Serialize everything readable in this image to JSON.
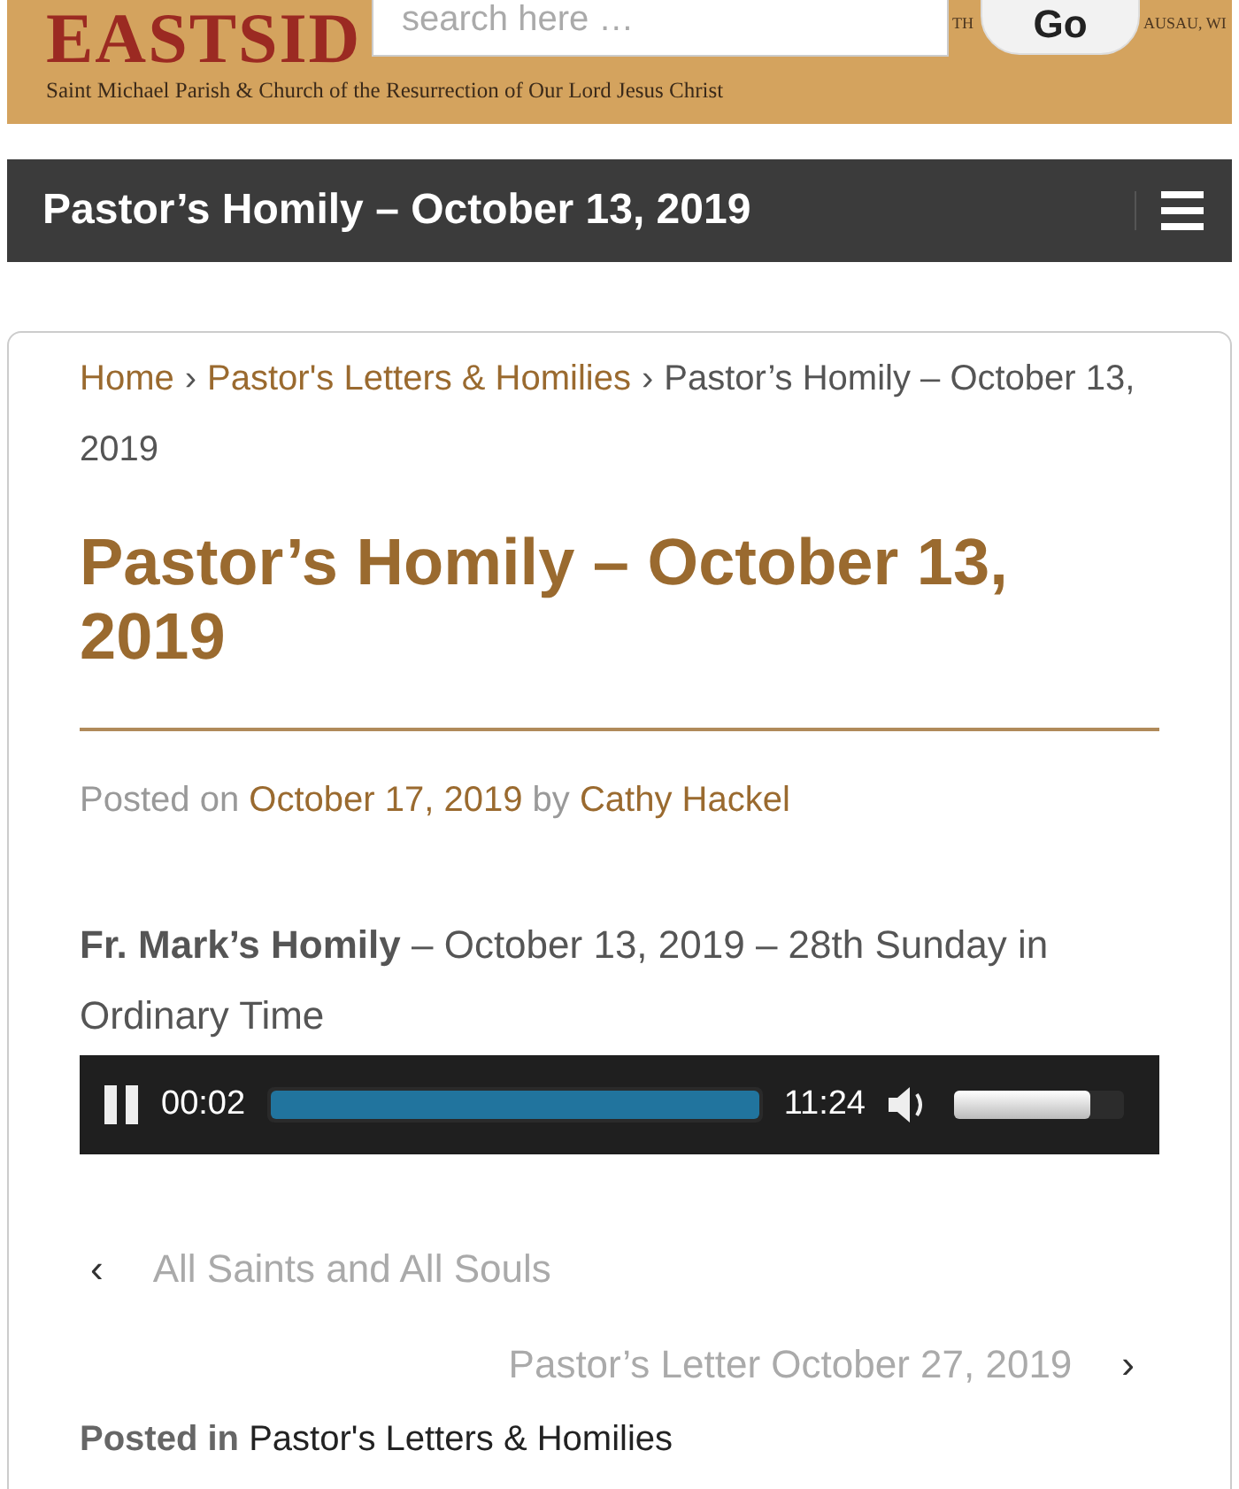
{
  "header": {
    "logo": "EASTSID",
    "tagline": "Saint Michael Parish & Church of the Resurrection of Our Lord Jesus Christ",
    "corner_left": "TH",
    "corner_right": "AUSAU, WI"
  },
  "search": {
    "placeholder": "search here …",
    "button": "Go"
  },
  "title_bar": {
    "title": "Pastor’s Homily – October 13, 2019"
  },
  "breadcrumb": [
    {
      "label": "Home",
      "kind": "link"
    },
    {
      "label": "Pastor's Letters & Homilies",
      "kind": "link"
    },
    {
      "label": "Pastor’s Homily – October 13, 2019",
      "kind": "current"
    }
  ],
  "breadcrumb_separator": "›",
  "post": {
    "title": "Pastor’s Homily – October 13, 2019",
    "posted_on": "Posted on",
    "date": "October 17, 2019",
    "by": "by",
    "author": "Cathy Hackel",
    "intro": "**Fr. Mark’s Homily** – October 13, 2019 – 28th Sunday in Ordinary Time"
  },
  "player": {
    "current": "00:02",
    "duration": "11:24",
    "level": 1,
    "volume": {
      "level": 0.8
    }
  },
  "nav": {
    "previous": {
      "arrow": "‹",
      "label": "All Saints and All Souls"
    },
    "next": {
      "arrow": "›",
      "label": "Pastor’s Letter October 27, 2019"
    }
  },
  "footer": {
    "label": "Posted in",
    "category": "Pastor's Letters & Homilies"
  }
}
